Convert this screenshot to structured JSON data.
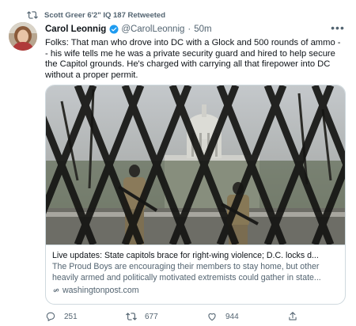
{
  "retweet": {
    "label": "Scott Greer 6'2\" IQ 187 Retweeted"
  },
  "author": {
    "name": "Carol Leonnig",
    "handle": "@CarolLeonnig",
    "separator": "·",
    "time": "50m"
  },
  "tweet": {
    "line1": "Folks: That man who drove into DC with a  Glock and 500 rounds of ammo -",
    "line2": "- his wife tells me he was a private security guard and hired to help secure",
    "line3": "the Capitol grounds. He's charged with carrying all that firepower into DC",
    "line4": "without a proper permit."
  },
  "card": {
    "title": "Live updates: State capitols brace for right-wing violence; D.C. locks d...",
    "desc_line1": "The Proud Boys are encouraging their members to stay home, but other",
    "desc_line2": "heavily armed and politically motivated extremists could gather in state...",
    "domain": "washingtonpost.com"
  },
  "actions": {
    "replies": "251",
    "retweets": "677",
    "likes": "944"
  },
  "colors": {
    "accent": "#1d9bf0",
    "secondary_text": "#536471",
    "border": "#cfd9de"
  },
  "icons": [
    "retweet-icon",
    "verified-badge-icon",
    "more-icon",
    "link-icon",
    "reply-icon",
    "like-icon",
    "share-icon"
  ]
}
